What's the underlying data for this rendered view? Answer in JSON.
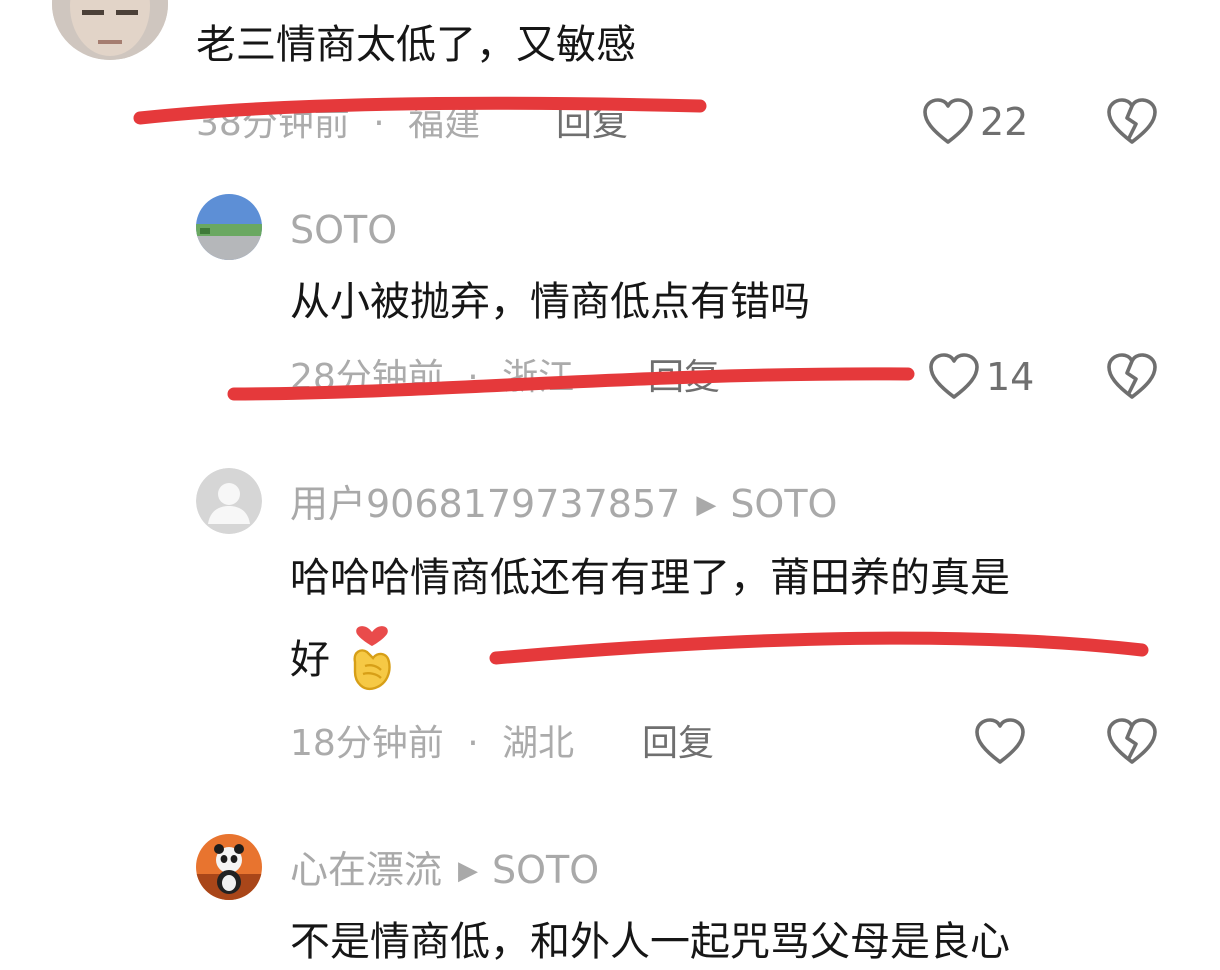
{
  "colors": {
    "annotation_red": "#e5393b",
    "username_gray": "#a9a9a9",
    "text_dark": "#161616",
    "icon_gray": "#6f6f6f"
  },
  "comments": [
    {
      "text": "老三情商太低了，又敏感",
      "time": "38分钟前",
      "sep": "·",
      "location": "福建",
      "reply_label": "回复",
      "likes": "22"
    },
    {
      "username": "SOTO",
      "text": "从小被抛弃，情商低点有错吗",
      "time": "28分钟前",
      "sep": "·",
      "location": "浙江",
      "reply_label": "回复",
      "likes": "14"
    },
    {
      "username": "用户9068179737857",
      "reply_to": "SOTO",
      "text_line1": "哈哈哈情商低还有有理了，莆田养的真是",
      "text_line2": "好",
      "emoji": "heart-hands-emoji",
      "time": "18分钟前",
      "sep": "·",
      "location": "湖北",
      "reply_label": "回复",
      "likes": ""
    },
    {
      "username": "心在漂流",
      "reply_to": "SOTO",
      "text": "不是情商低，和外人一起咒骂父母是良心"
    }
  ]
}
